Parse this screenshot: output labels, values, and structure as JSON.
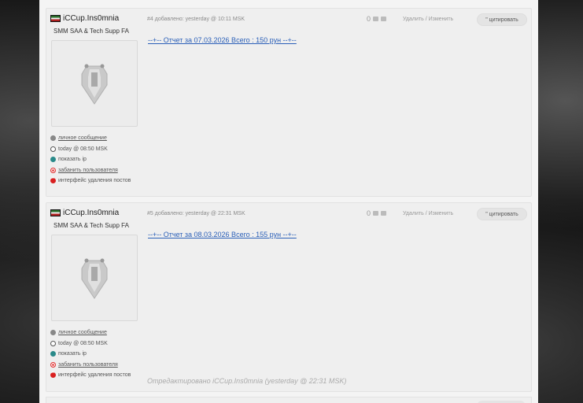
{
  "posts": [
    {
      "author": "iCCup.Ins0mnia",
      "user_title": "SMM SAA & Tech Supp FA",
      "meta": "#4 добавлено: yesterday @ 10:11 MSK",
      "vote_count": "0",
      "delete_label": "Удалить",
      "separator": "/",
      "edit_label": "Изменить",
      "quote_label": "\" цитировать",
      "body_link": "--+-- Отчет за 07.03.2026 Всего : 150 рун --+--",
      "links": {
        "pm": "личное сообщение",
        "time": "today @ 08:50 MSK",
        "ip": "показать ip",
        "ban": "забанить пользователя",
        "del": "интерфейс удаления постов"
      },
      "edited_note": ""
    },
    {
      "author": "iCCup.Ins0mnia",
      "user_title": "SMM SAA & Tech Supp FA",
      "meta": "#5 добавлено: yesterday @ 22:31 MSK",
      "vote_count": "0",
      "delete_label": "Удалить",
      "separator": "/",
      "edit_label": "Изменить",
      "quote_label": "\" цитировать",
      "body_link": "--+-- Отчет за 08.03.2026 Всего : 155 рун --+--",
      "links": {
        "pm": "личное сообщение",
        "time": "today @ 08:50 MSK",
        "ip": "показать ip",
        "ban": "забанить пользователя",
        "del": "интерфейс удаления постов"
      },
      "edited_note": "Отредактировано iCCup.Ins0mnia (yesterday @ 22:31 MSK)"
    }
  ]
}
